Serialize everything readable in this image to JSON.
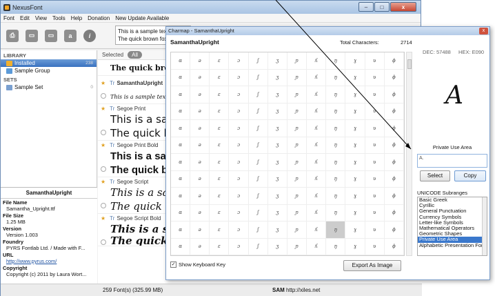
{
  "window": {
    "title": "NexusFont",
    "min": "–",
    "max": "□",
    "close": "x"
  },
  "menu": [
    "Font",
    "Edit",
    "View",
    "Tools",
    "Help",
    "Donation",
    "New Update Available"
  ],
  "toolbar": {
    "sample_line1": "This is a sample text",
    "sample_line2": "The quick brown fox"
  },
  "library": {
    "header": "LIBRARY",
    "items": [
      {
        "label": "Installed",
        "count": "238"
      },
      {
        "label": "Sample Group",
        "count": ""
      }
    ]
  },
  "sets": {
    "header": "SETS",
    "items": [
      {
        "label": "Sample Set",
        "count": "0"
      }
    ]
  },
  "info": {
    "font": "SamanthaUpright",
    "file_name_key": "File Name",
    "file_name": "Samantha_Upright.ttf",
    "file_size_key": "File Size",
    "file_size": "1.25 MB",
    "version_key": "Version",
    "version": "Version 1.003",
    "foundry_key": "Foundry",
    "foundry": "PYRS Fontlab Ltd. / Made with F...",
    "url_key": "URL",
    "url": "http://www.pyrus.com/",
    "copyright_key": "Copyright",
    "copyright": "Copyright (c) 2011 by Laura Wort..."
  },
  "left_footer": {
    "add": "+",
    "info": "i"
  },
  "tabs": [
    {
      "label": "Selected"
    },
    {
      "label": "All"
    }
  ],
  "fonts": [
    {
      "name": "",
      "line1": "The quick brown f",
      "style": "bold serif"
    },
    {
      "name": "SamanthaUpright",
      "line1": "This is a sample text in",
      "style": "script"
    },
    {
      "name": "Segoe Print",
      "line1": "This is a sam",
      "line2": "The quick b"
    },
    {
      "name": "Segoe Print Bold",
      "line1": "This is a sam",
      "line2": "The quick b"
    },
    {
      "name": "Segoe Script",
      "line1": "This is a sa",
      "line2": "The quick"
    },
    {
      "name": "Segoe Script Bold",
      "line1": "This is a sa",
      "line2": "The quick brown fox jumps over the lazy dog"
    }
  ],
  "status": {
    "count": "259 Font(s) (325.99 MB)",
    "sam": "SAM",
    "url": "http://xiles.net"
  },
  "charmap": {
    "title": "Charmap - SamanthaUpright",
    "close": "x",
    "font": "SamanthaUpright",
    "total_label": "Total Characters:",
    "total": "2714",
    "dec": "DEC: 57488",
    "hex": "HEX: E090",
    "preview": "A",
    "area": "Private Use Area",
    "field": "A.",
    "select": "Select",
    "copy": "Copy",
    "subranges_label": "UNICODE Subranges",
    "subranges": [
      "Basic Greek",
      "Cyrillic",
      "General Punctuation",
      "Currency Symbols",
      "Letter-like Symbols",
      "Mathematical Operators",
      "Geometric Shapes",
      "Private Use Area",
      "Alphabetic Presentation Forms"
    ],
    "selected_subrange": 7,
    "show_kb": "Show Keyboard Key",
    "show_kb_checked": true,
    "export": "Export As Image"
  }
}
